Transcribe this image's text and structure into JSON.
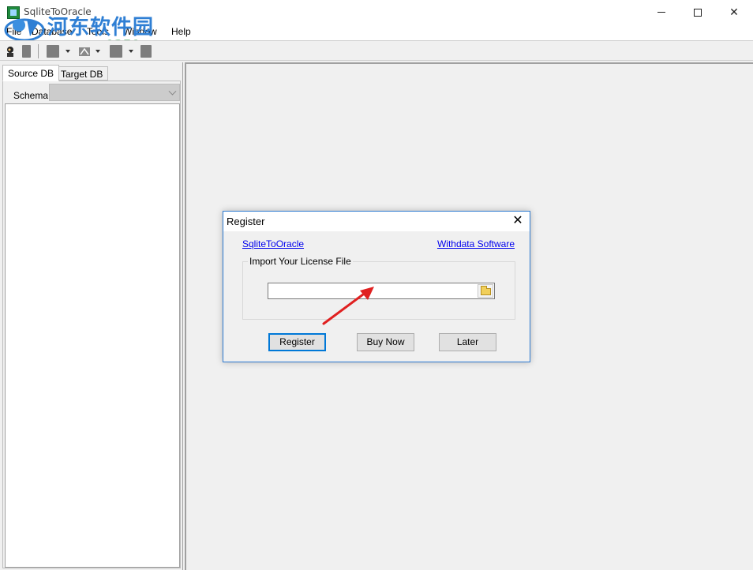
{
  "window": {
    "title": "SqliteToOracle"
  },
  "watermark": {
    "brand": "河东软件园",
    "url": "www.pc0359.cn"
  },
  "menu": {
    "file": "File",
    "database": "Database",
    "tools": "Tools",
    "window": "Window",
    "help": "Help"
  },
  "left_panel": {
    "tabs": [
      "Source DB",
      "Target DB"
    ],
    "schema_label": "Schema",
    "schema_value": ""
  },
  "dialog": {
    "title": "Register",
    "app_link": "SqliteToOracle",
    "vendor_link": "Withdata Software",
    "group_label": "Import Your License File",
    "license_path": "",
    "buttons": {
      "register": "Register",
      "buy_now": "Buy Now",
      "later": "Later"
    }
  },
  "colors": {
    "dialog_border": "#2f7bd1",
    "link": "#0000ee",
    "annotation_arrow": "#e02020",
    "watermark_blue": "#2f7fd4",
    "watermark_green": "#1e9a3a"
  }
}
